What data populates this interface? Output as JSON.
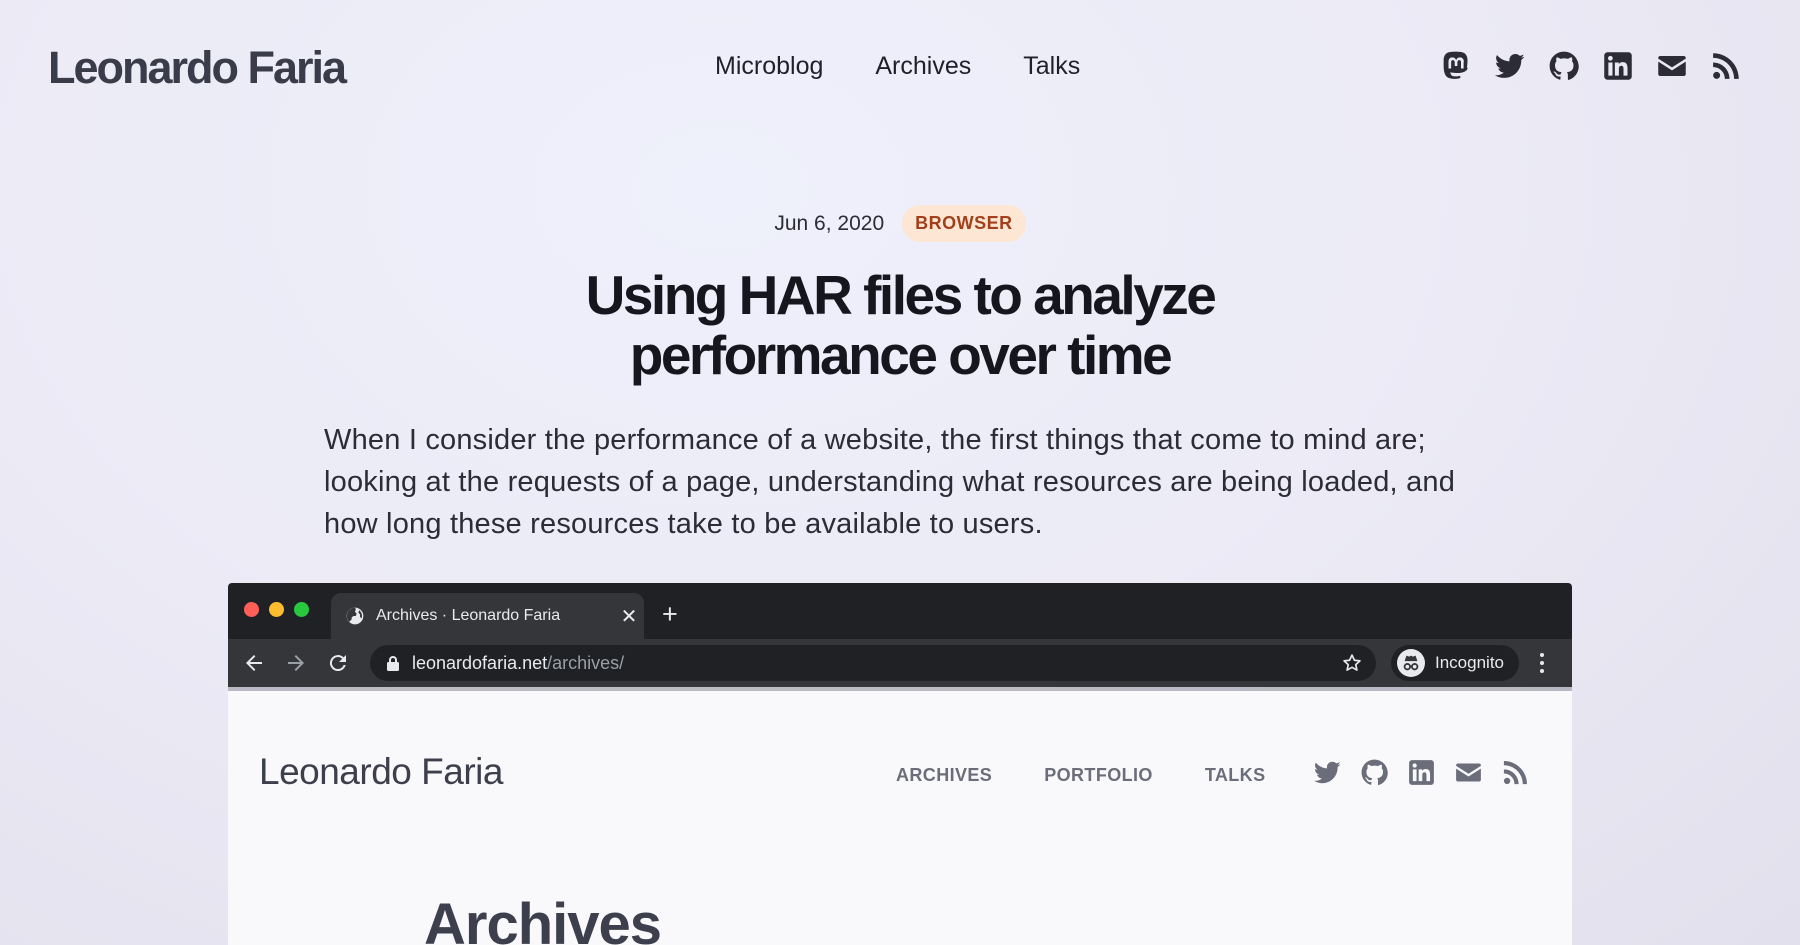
{
  "site": {
    "brand": "Leonardo Faria",
    "nav": [
      "Microblog",
      "Archives",
      "Talks"
    ],
    "social_icons": [
      "mastodon-icon",
      "twitter-icon",
      "github-icon",
      "linkedin-icon",
      "email-icon",
      "rss-icon"
    ]
  },
  "article": {
    "date": "Jun 6, 2020",
    "tag": "BROWSER",
    "title": "Using HAR files to analyze performance over time",
    "lead": "When I consider the performance of a website, the first things that come to mind are; looking at the requests of a page, understanding what resources are being loaded, and how long these resources take to be available to users."
  },
  "browser": {
    "tab_title": "Archives · Leonardo Faria",
    "url_host": "leonardofaria.net",
    "url_path": "/archives/",
    "incognito_label": "Incognito",
    "colors": {
      "close": "#ff5f57",
      "minimize": "#febc2e",
      "maximize": "#28c840"
    }
  },
  "inner_page": {
    "brand": "Leonardo Faria",
    "nav": [
      "ARCHIVES",
      "PORTFOLIO",
      "TALKS"
    ],
    "social_icons": [
      "twitter-icon",
      "github-icon",
      "linkedin-icon",
      "email-icon",
      "rss-icon"
    ],
    "heading": "Archives"
  }
}
